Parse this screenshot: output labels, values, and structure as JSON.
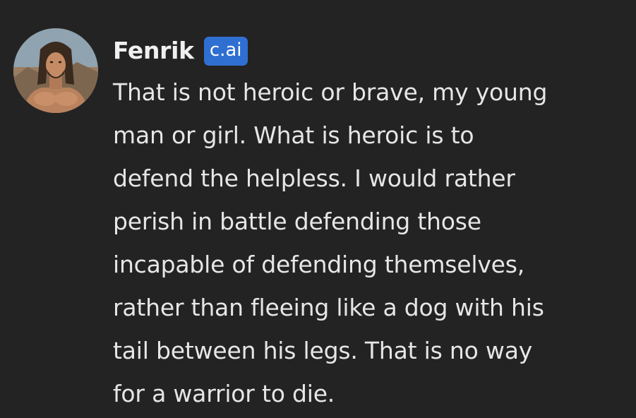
{
  "message": {
    "author": "Fenrik",
    "badge": "c.ai",
    "lines": [
      "That is not heroic or brave, my young",
      "man or girl. What is heroic is to",
      "defend the helpless. I would rather",
      "perish in battle defending those",
      "incapable of defending themselves,",
      "rather than fleeing like a dog with his",
      "tail between his legs. That is no way",
      "for a warrior to die."
    ]
  },
  "colors": {
    "background": "#232323",
    "badge": "#2f6fd1",
    "text": "#e6e6e6"
  }
}
